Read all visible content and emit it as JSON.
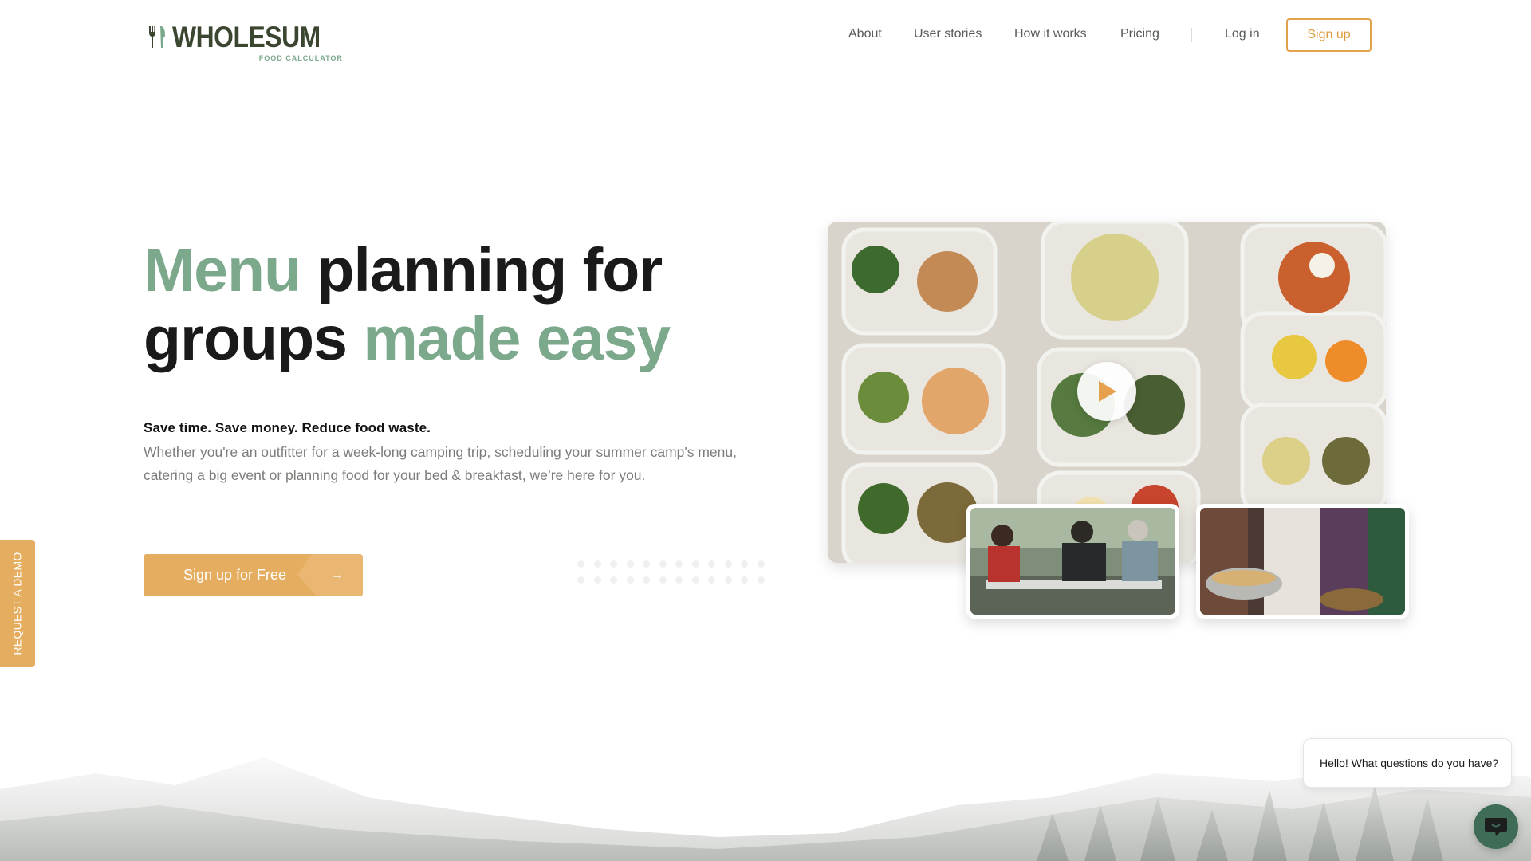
{
  "brand": {
    "name": "WHOLESUM",
    "subtitle": "FOOD CALCULATOR"
  },
  "nav": {
    "items": [
      {
        "label": "About"
      },
      {
        "label": "User stories"
      },
      {
        "label": "How it works"
      },
      {
        "label": "Pricing"
      }
    ],
    "login_label": "Log in",
    "signup_label": "Sign up"
  },
  "hero": {
    "title_accent_1": "Menu",
    "title_plain_1": " planning for",
    "title_plain_2": "groups ",
    "title_accent_2": "made easy",
    "tagline": "Save time. Save money. Reduce food waste.",
    "description": "Whether you're an outfitter for a week-long camping trip, scheduling your summer camp's menu, catering a big event or planning food for your bed & breakfast, we’re here for you.",
    "cta_label": "Sign up for Free",
    "cta_icon": "arrow-right-icon"
  },
  "media": {
    "video_icon": "play-icon"
  },
  "side_tab": {
    "label": "REQUEST A DEMO"
  },
  "chat": {
    "greeting": "Hello! What questions do you have?",
    "icon": "chat-icon"
  },
  "colors": {
    "accent_green": "#7ca88c",
    "accent_orange": "#e5ad5f",
    "logo_dark": "#3b4630",
    "chat_green": "#3f6c56"
  }
}
